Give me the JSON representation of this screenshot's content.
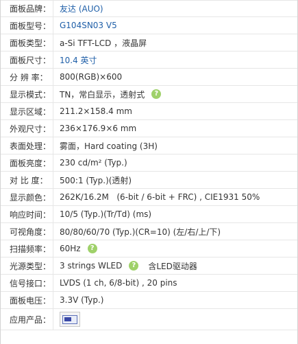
{
  "specs": [
    {
      "label": "面板品牌：",
      "value": "友达 (AUO)",
      "link": true
    },
    {
      "label": "面板型号：",
      "value": "G104SN03 V5",
      "link": true
    },
    {
      "label": "面板类型：",
      "value": "a-Si TFT-LCD ，液晶屏"
    },
    {
      "label": "面板尺寸：",
      "value": "10.4 英寸",
      "link": true
    },
    {
      "label": "分 辨 率：",
      "value": "800(RGB)×600"
    },
    {
      "label": "显示模式：",
      "value": "TN，常白显示，透射式",
      "help": true
    },
    {
      "label": "显示区域：",
      "value": "211.2×158.4 mm"
    },
    {
      "label": "外观尺寸：",
      "value": "236×176.9×6 mm"
    },
    {
      "label": "表面处理：",
      "value": "雾面，Hard coating (3H)"
    },
    {
      "label": "面板亮度：",
      "value": "230 cd/m² (Typ.)"
    },
    {
      "label": "对 比 度：",
      "value": "500:1 (Typ.)(透射)"
    },
    {
      "label": "显示颜色：",
      "value": "262K/16.2M   (6-bit / 6-bit + FRC) , CIE1931 50%"
    },
    {
      "label": "响应时间：",
      "value": "10/5 (Typ.)(Tr/Td) (ms)"
    },
    {
      "label": "可视角度：",
      "value": "80/80/60/70 (Typ.)(CR=10) (左/右/上/下)"
    },
    {
      "label": "扫描频率：",
      "value": "60Hz",
      "help": true
    },
    {
      "label": "光源类型：",
      "value": "3 strings WLED",
      "help": true,
      "after": "含LED驱动器"
    },
    {
      "label": "信号接口：",
      "value": "LVDS (1 ch, 6/8-bit) , 20 pins"
    },
    {
      "label": "面板电压：",
      "value": "3.3V (Typ.)"
    },
    {
      "label": "应用产品：",
      "value": "",
      "product_icon": "monitor-product-thumbnail"
    }
  ],
  "help_glyph": "?",
  "colors": {
    "link": "#1f5fa8",
    "help": "#9fd16a",
    "border": "#e6e6e6"
  }
}
